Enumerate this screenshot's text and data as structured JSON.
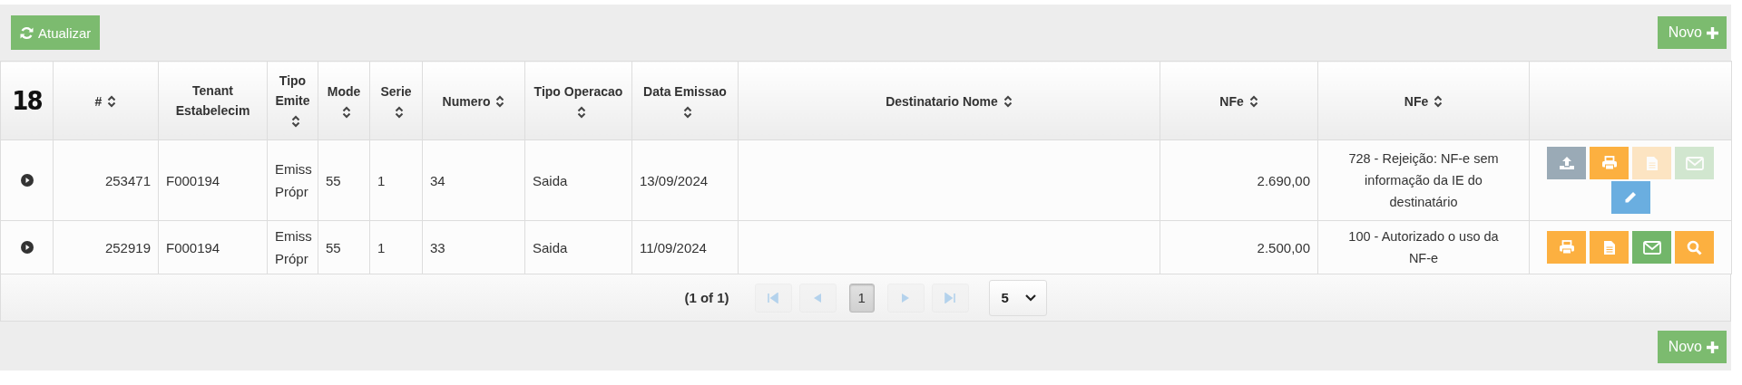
{
  "toolbar": {
    "refresh_button": "Atualizar",
    "new_button": "Novo"
  },
  "table": {
    "counter": "18",
    "columns": [
      {
        "label": "#",
        "sortable": true
      },
      {
        "label": "Tenant Estabelecim",
        "sortable": false
      },
      {
        "label": "Tipo Emite",
        "sortable": true
      },
      {
        "label": "Mode",
        "sortable": true
      },
      {
        "label": "Serie",
        "sortable": true
      },
      {
        "label": "Numero",
        "sortable": true
      },
      {
        "label": "Tipo Operacao",
        "sortable": true
      },
      {
        "label": "Data Emissao",
        "sortable": true
      },
      {
        "label": "Destinatario Nome",
        "sortable": true
      },
      {
        "label": "NFe",
        "sortable": true
      },
      {
        "label": "NFe",
        "sortable": true
      },
      {
        "sortable": false
      }
    ],
    "rows": [
      {
        "id": "253471",
        "tenant": "F000194",
        "tipo_emitente": "Emiss Própr",
        "modelo": "55",
        "serie": "1",
        "numero": "34",
        "tipo_operacao": "Saida",
        "data_emissao": "13/09/2024",
        "valor": "2.690,00",
        "status": "728 - Rejeição: NF-e sem informação da IE do destinatário",
        "actions": [
          {
            "kind": "upload",
            "disabled": false
          },
          {
            "kind": "print",
            "disabled": false
          },
          {
            "kind": "document",
            "disabled": true
          },
          {
            "kind": "email",
            "disabled": true
          },
          {
            "kind": "edit",
            "disabled": false
          }
        ]
      },
      {
        "id": "252919",
        "tenant": "F000194",
        "tipo_emitente": "Emiss Própr",
        "modelo": "55",
        "serie": "1",
        "numero": "33",
        "tipo_operacao": "Saida",
        "data_emissao": "11/09/2024",
        "valor": "2.500,00",
        "status": "100 - Autorizado o uso da NF-e",
        "actions": [
          {
            "kind": "print",
            "disabled": false
          },
          {
            "kind": "document",
            "disabled": false
          },
          {
            "kind": "email",
            "disabled": false
          },
          {
            "kind": "search",
            "disabled": false
          }
        ]
      }
    ]
  },
  "paginator": {
    "summary": "(1 of 1)",
    "nav": [
      {
        "kind": "first",
        "disabled": true
      },
      {
        "kind": "prev",
        "disabled": true
      },
      {
        "kind": "pages"
      },
      {
        "kind": "next",
        "disabled": true
      },
      {
        "kind": "last",
        "disabled": true
      }
    ],
    "pages": [
      {
        "label": "1",
        "selected": true
      }
    ],
    "rows_per_page": "5"
  },
  "footer": {
    "new_button": "Novo"
  }
}
